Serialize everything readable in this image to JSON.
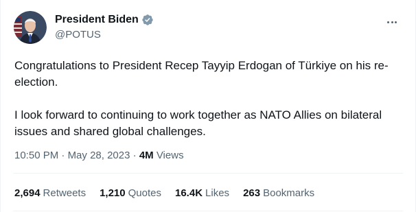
{
  "author": {
    "name": "President Biden",
    "handle": "@POTUS"
  },
  "tweet": {
    "paragraphs": [
      "Congratulations to President Recep Tayyip Erdogan of Türkiye on his re-election.",
      "I look forward to continuing to work together as NATO Allies on bilateral issues and shared global challenges."
    ]
  },
  "meta": {
    "time": "10:50 PM",
    "separator": " · ",
    "date": "May 28, 2023",
    "views_count": "4M",
    "views_label": " Views"
  },
  "stats": {
    "retweets": {
      "count": "2,694",
      "label": "Retweets"
    },
    "quotes": {
      "count": "1,210",
      "label": "Quotes"
    },
    "likes": {
      "count": "16.4K",
      "label": "Likes"
    },
    "bookmarks": {
      "count": "263",
      "label": "Bookmarks"
    }
  },
  "colors": {
    "verified_badge": "#829aab",
    "text_primary": "#0f1419",
    "text_secondary": "#536471"
  },
  "icons": {
    "verified": "verified-badge-icon",
    "more": "more-options-icon"
  }
}
